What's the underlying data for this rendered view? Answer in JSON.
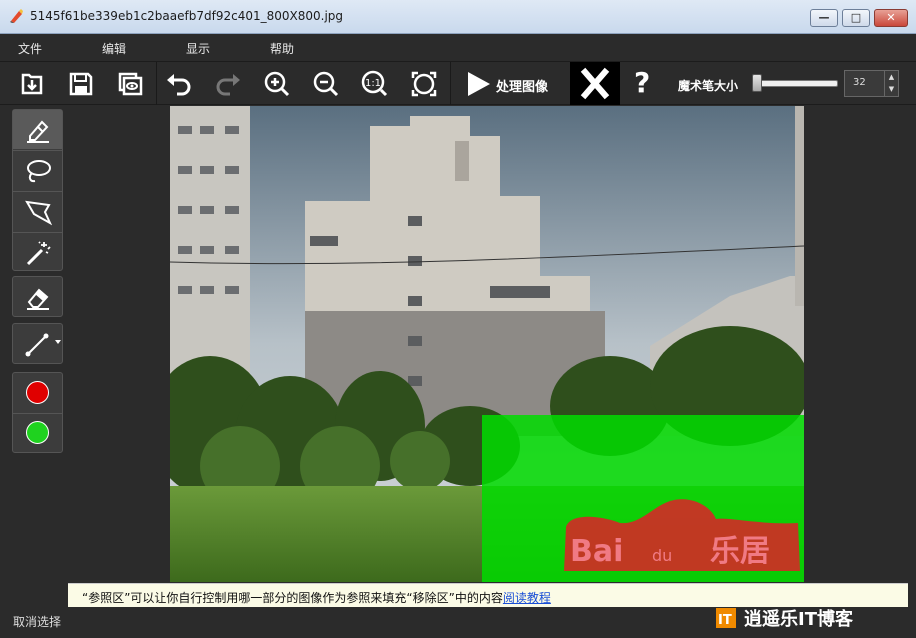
{
  "window": {
    "title": "5145f61be339eb1c2baaefb7df92c401_800X800.jpg",
    "controls": {
      "minimize": "—",
      "maximize": "□",
      "close": "✕"
    }
  },
  "menu": [
    "文件",
    "编辑",
    "显示",
    "帮助"
  ],
  "toolbar": {
    "icons": [
      "open-icon",
      "save-icon",
      "preview-icon",
      "undo-icon",
      "redo-icon",
      "zoom-in-icon",
      "zoom-out-icon",
      "actual-size-icon",
      "fit-icon"
    ],
    "actual_size_label": "1:1",
    "process_label": "处理图像",
    "help_label": "?",
    "brush_size_label": "魔术笔大小",
    "brush_size_value": "32",
    "spin_up": "▲",
    "spin_down": "▼"
  },
  "tools": {
    "items": [
      "marker-tool",
      "lasso-tool",
      "polygon-lasso-tool",
      "magic-wand-tool",
      "eraser-tool",
      "line-tool"
    ],
    "colors": {
      "red": "#e00000",
      "green": "#1fd21f"
    }
  },
  "info": {
    "message": "“参照区”可以让你自行控制用哪一部分的图像作为参照来填充“移除区”中的内容",
    "link": "阅读教程"
  },
  "status": {
    "text": "取消选择"
  },
  "watermark": {
    "text": "逍遥乐IT博客",
    "logo": "IT"
  },
  "overlay": {
    "mark_text": "Bai",
    "mark_small": "du",
    "mark_cn": "乐居"
  }
}
